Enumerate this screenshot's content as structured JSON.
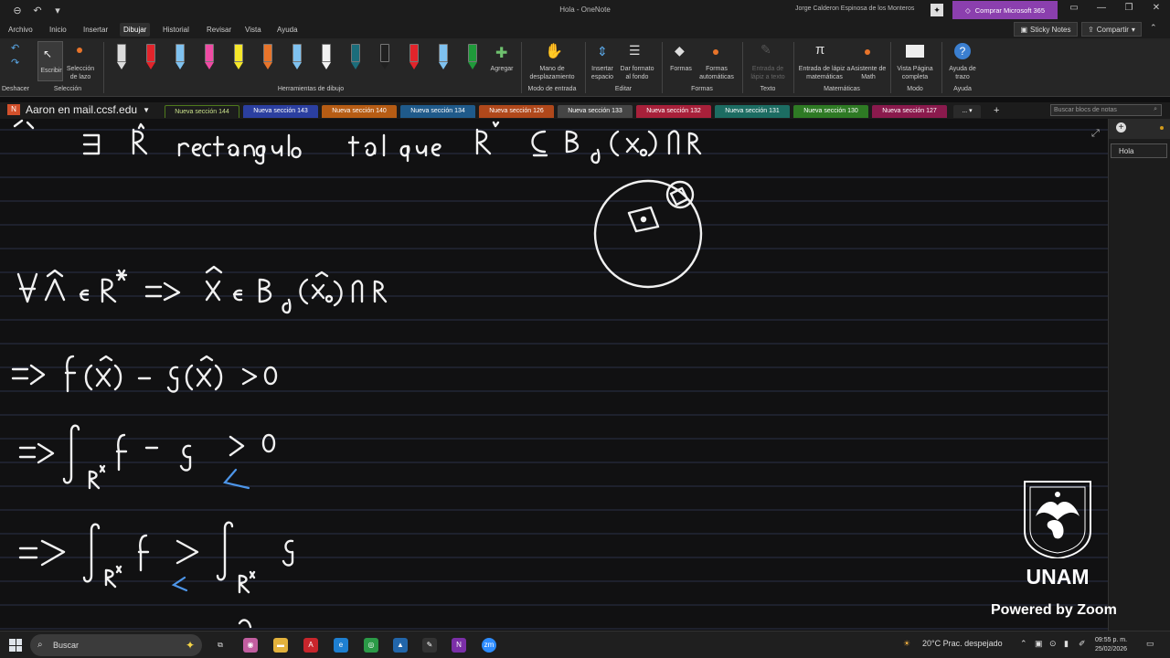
{
  "window": {
    "title": "Hola - OneNote",
    "user": "Jorge Calderon Espinosa de los Monteros",
    "buy_label": "Comprar Microsoft 365"
  },
  "menu": {
    "items": [
      "Archivo",
      "Inicio",
      "Insertar",
      "Dibujar",
      "Historial",
      "Revisar",
      "Vista",
      "Ayuda"
    ],
    "active": "Dibujar",
    "sticky_notes": "Sticky Notes",
    "share": "Compartir"
  },
  "ribbon": {
    "undo_group": "Deshacer",
    "write_label": "Escribir",
    "lasso_label": "Selección de lazo",
    "selection_group": "Selección",
    "pens_group": "Herramientas de dibujo",
    "add_label": "Agregar",
    "pan_label": "Mano de desplazamiento",
    "input_mode_group": "Modo de entrada",
    "insert_space": "Insertar espacio",
    "format_bg": "Dar formato al fondo",
    "edit_group": "Editar",
    "shapes": "Formas",
    "auto_shapes": "Formas automáticas",
    "shapes_group": "Formas",
    "ink_to_text": "Entrada de lápiz a texto",
    "text_group": "Texto",
    "ink_math": "Entrada de lápiz a matemáticas",
    "math_assistant": "Asistente de Math",
    "math_group": "Matemáticas",
    "full_page": "Vista Página completa",
    "mode_group": "Modo",
    "ink_help": "Ayuda de trazo",
    "help_group": "Ayuda",
    "pen_colors": [
      "#dcdcdc",
      "#e2242b",
      "#7fc2f0",
      "#ef4ba4",
      "#f5e72a",
      "#e8742a",
      "#7fc2f0",
      "#f2f2f2",
      "#1b6d7b",
      "#202020",
      "#e2242b",
      "#7fc2f0",
      "#1f9a3a"
    ]
  },
  "notebook": {
    "name": "Aaron en mail.ccsf.edu",
    "sections": [
      {
        "label": "Nueva sección 144",
        "color": "#4f7a1c",
        "active": true
      },
      {
        "label": "Nueva sección 143",
        "color": "#2b3fa0"
      },
      {
        "label": "Nueva sección 140",
        "color": "#b65c14"
      },
      {
        "label": "Nueva sección 134",
        "color": "#1f5a8a"
      },
      {
        "label": "Nueva sección 126",
        "color": "#b0481b"
      },
      {
        "label": "Nueva sección 133",
        "color": "#454545"
      },
      {
        "label": "Nueva sección 132",
        "color": "#a8203a"
      },
      {
        "label": "Nueva sección 131",
        "color": "#1c6c62"
      },
      {
        "label": "Nueva sección 130",
        "color": "#2e7a24"
      },
      {
        "label": "Nueva sección 127",
        "color": "#8a1a4d"
      }
    ],
    "more": "...",
    "search_placeholder": "Buscar blocs de notas"
  },
  "pages": {
    "items": [
      "Hola"
    ]
  },
  "overlay": {
    "logo_text": "UNAM",
    "powered": "Powered by Zoom"
  },
  "taskbar": {
    "search": "Buscar",
    "weather": "20°C  Prac. despejado",
    "time": "09:55 p. m.",
    "date": "25/02/2026"
  }
}
